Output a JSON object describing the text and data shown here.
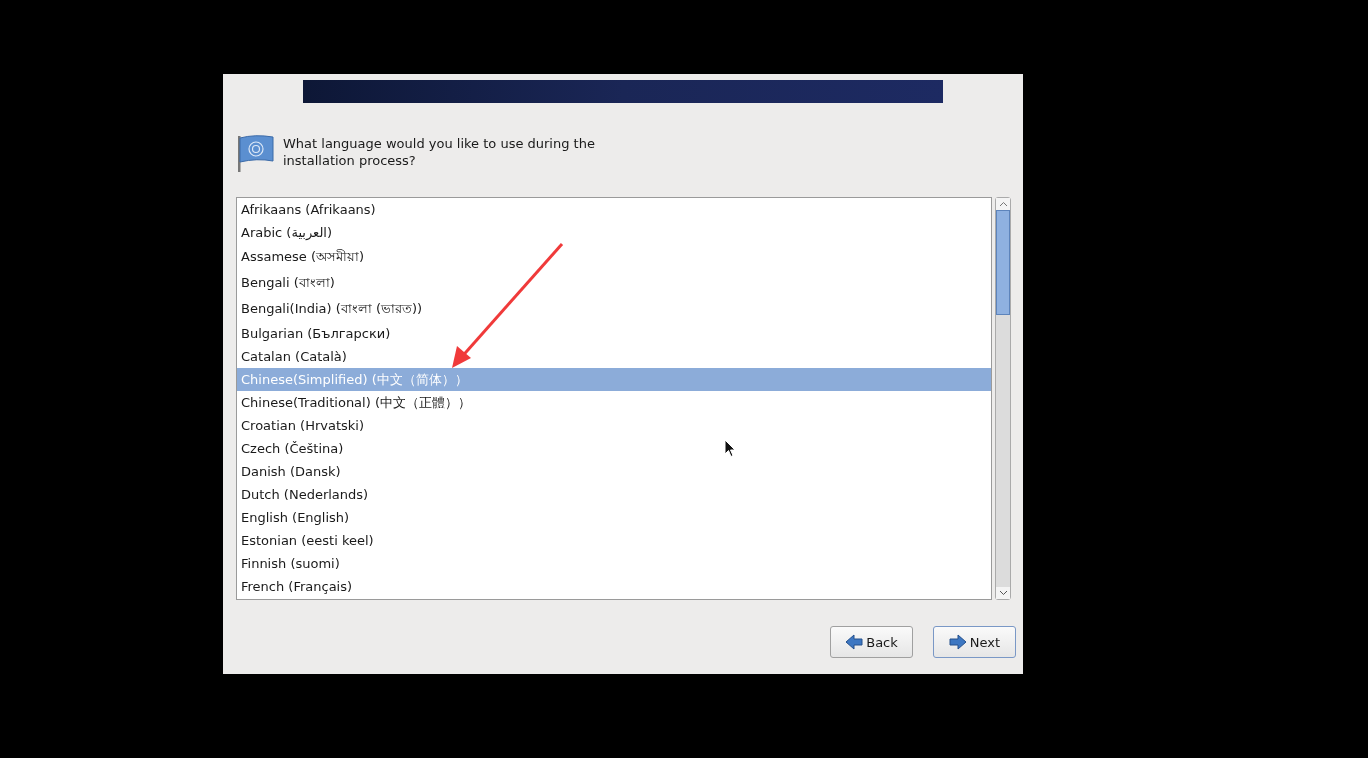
{
  "prompt": "What language would you like to use during the installation process?",
  "languages": [
    {
      "label": "Afrikaans (Afrikaans)",
      "selected": false
    },
    {
      "label": "Arabic (العربية)",
      "selected": false
    },
    {
      "label": "Assamese (অসমীয়া)",
      "selected": false
    },
    {
      "label": "Bengali (বাংলা)",
      "selected": false
    },
    {
      "label": "Bengali(India) (বাংলা (ভারত))",
      "selected": false
    },
    {
      "label": "Bulgarian (Български)",
      "selected": false
    },
    {
      "label": "Catalan (Català)",
      "selected": false
    },
    {
      "label": "Chinese(Simplified) (中文（简体））",
      "selected": true
    },
    {
      "label": "Chinese(Traditional) (中文（正體））",
      "selected": false
    },
    {
      "label": "Croatian (Hrvatski)",
      "selected": false
    },
    {
      "label": "Czech (Čeština)",
      "selected": false
    },
    {
      "label": "Danish (Dansk)",
      "selected": false
    },
    {
      "label": "Dutch (Nederlands)",
      "selected": false
    },
    {
      "label": "English (English)",
      "selected": false
    },
    {
      "label": "Estonian (eesti keel)",
      "selected": false
    },
    {
      "label": "Finnish (suomi)",
      "selected": false
    },
    {
      "label": "French (Français)",
      "selected": false
    }
  ],
  "buttons": [
    {
      "label": "Back",
      "kind": "back"
    },
    {
      "label": "Next",
      "kind": "next"
    }
  ]
}
